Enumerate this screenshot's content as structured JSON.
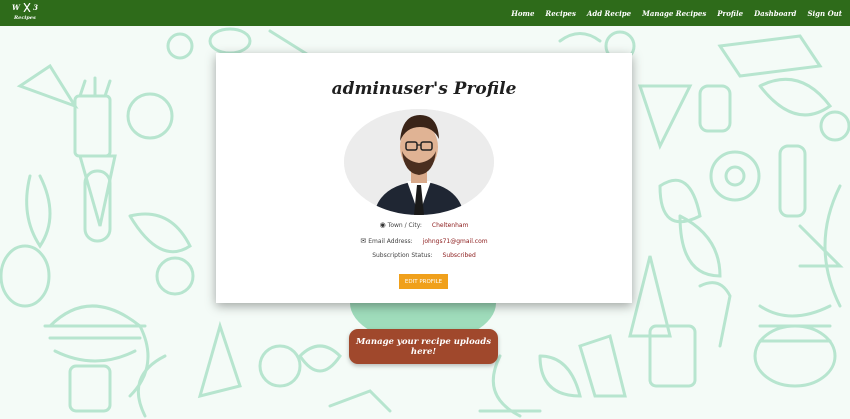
{
  "nav": {
    "logo_top_left": "W",
    "logo_top_right": "3",
    "logo_sub": "Recipes",
    "links": [
      "Home",
      "Recipes",
      "Add Recipe",
      "Manage Recipes",
      "Profile",
      "Dashboard",
      "Sign Out"
    ]
  },
  "profile": {
    "title": "adminuser's Profile",
    "town_label": "Town / City:",
    "town_value": "Cheltenham",
    "email_label": "Email Address:",
    "email_value": "johngs71@gmail.com",
    "subscription_label": "Subscription Status:",
    "subscription_value": "Subscribed",
    "edit_button": "EDIT PROFILE"
  },
  "cta": {
    "label": "Manage your recipe uploads here!"
  },
  "colors": {
    "navbar": "#2e6b1a",
    "edit_button": "#f0a01b",
    "cta_button": "#a0482c",
    "value_text": "#8b1a1a",
    "doodle": "#b7e5cf"
  }
}
